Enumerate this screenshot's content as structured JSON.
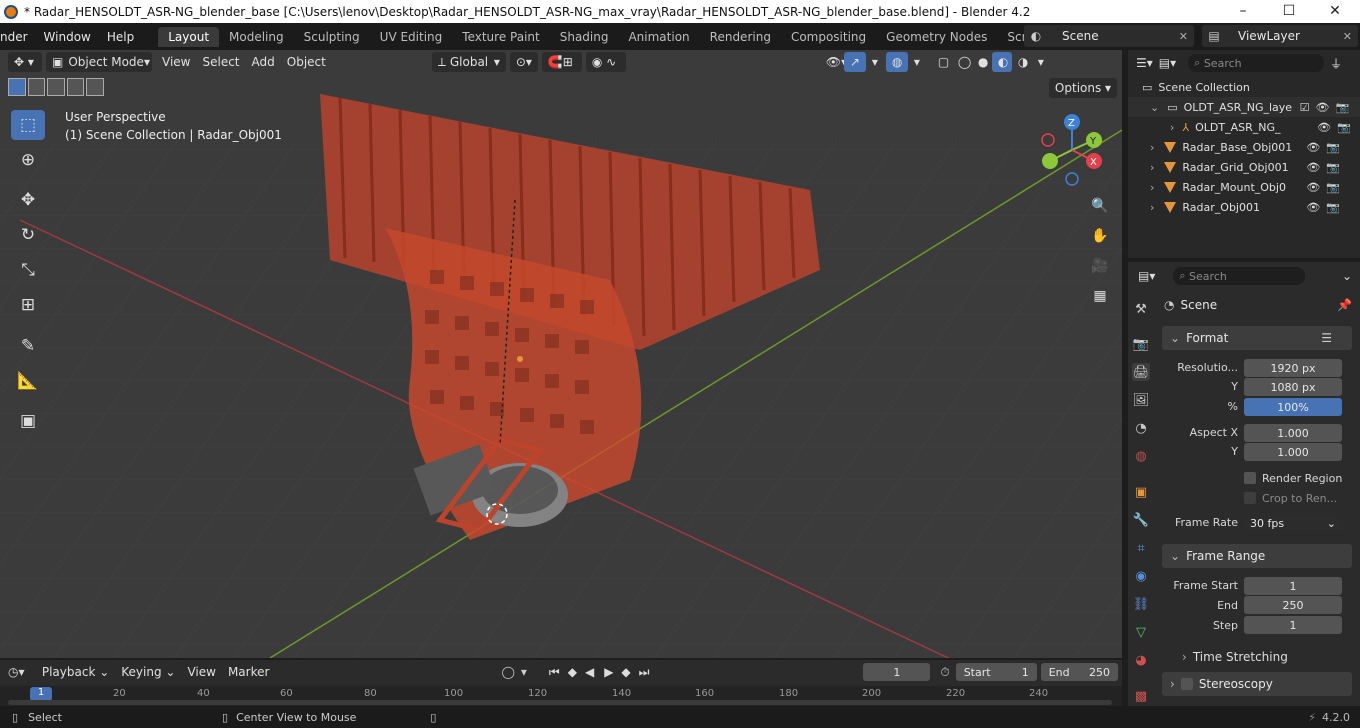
{
  "window": {
    "title": "* Radar_HENSOLDT_ASR-NG_blender_base [C:\\Users\\lenov\\Desktop\\Radar_HENSOLDT_ASR-NG_max_vray\\Radar_HENSOLDT_ASR-NG_blender_base.blend] - Blender 4.2",
    "controls": [
      "–",
      "☐",
      "✕"
    ]
  },
  "topbar": {
    "menus": [
      "nder",
      "Window",
      "Help"
    ],
    "workspaces": [
      "Layout",
      "Modeling",
      "Sculpting",
      "UV Editing",
      "Texture Paint",
      "Shading",
      "Animation",
      "Rendering",
      "Compositing",
      "Geometry Nodes",
      "Scripting"
    ],
    "active_workspace": "Layout",
    "add_tab": "+",
    "scene": "Scene",
    "view_layer": "ViewLayer"
  },
  "viewport": {
    "mode": "Object Mode",
    "menus": [
      "View",
      "Select",
      "Add",
      "Object"
    ],
    "transform_orientation": "Global",
    "overlay_text_1": "User Perspective",
    "overlay_text_2": "(1) Scene Collection | Radar_Obj001",
    "options_label": "Options",
    "gizmo_axes": [
      "Z",
      "Y",
      "X"
    ],
    "colors": {
      "x": "#e2404d",
      "y": "#8bc83a",
      "z": "#3c82d6",
      "object": "#e0442a"
    }
  },
  "outliner": {
    "search_placeholder": "Search",
    "root": "Scene Collection",
    "items": [
      {
        "label": "OLDT_ASR_NG_laye",
        "type": "collection",
        "indent": 1
      },
      {
        "label": "OLDT_ASR_NG_",
        "type": "empty",
        "indent": 2
      },
      {
        "label": "Radar_Base_Obj001",
        "type": "mesh",
        "indent": 1
      },
      {
        "label": "Radar_Grid_Obj001",
        "type": "mesh",
        "indent": 1
      },
      {
        "label": "Radar_Mount_Obj0",
        "type": "mesh",
        "indent": 1
      },
      {
        "label": "Radar_Obj001",
        "type": "mesh",
        "indent": 1
      }
    ]
  },
  "properties": {
    "search_placeholder": "Search",
    "context": "Scene",
    "format": {
      "header": "Format",
      "resolution_label": "Resolutio...",
      "res_x": "1920 px",
      "y_label": "Y",
      "res_y": "1080 px",
      "pct_label": "%",
      "res_pct": "100%",
      "aspect_label": "Aspect X",
      "aspect_x": "1.000",
      "aspect_y_label": "Y",
      "aspect_y": "1.000",
      "render_region": "Render Region",
      "crop": "Crop to Ren...",
      "frame_rate_label": "Frame Rate",
      "frame_rate": "30 fps"
    },
    "frame_range": {
      "header": "Frame Range",
      "start_label": "Frame Start",
      "start": "1",
      "end_label": "End",
      "end": "250",
      "step_label": "Step",
      "step": "1"
    },
    "time_stretching": "Time Stretching",
    "stereoscopy": "Stereoscopy"
  },
  "timeline": {
    "menus": [
      "Playback",
      "Keying",
      "View",
      "Marker"
    ],
    "current_frame": "1",
    "start_label": "Start",
    "start": "1",
    "end_label": "End",
    "end": "250",
    "ticks": [
      "1",
      "20",
      "40",
      "60",
      "80",
      "100",
      "120",
      "140",
      "160",
      "180",
      "200",
      "220",
      "240"
    ]
  },
  "statusbar": {
    "select": "Select",
    "center_view": "Center View to Mouse",
    "version": "4.2.0"
  }
}
